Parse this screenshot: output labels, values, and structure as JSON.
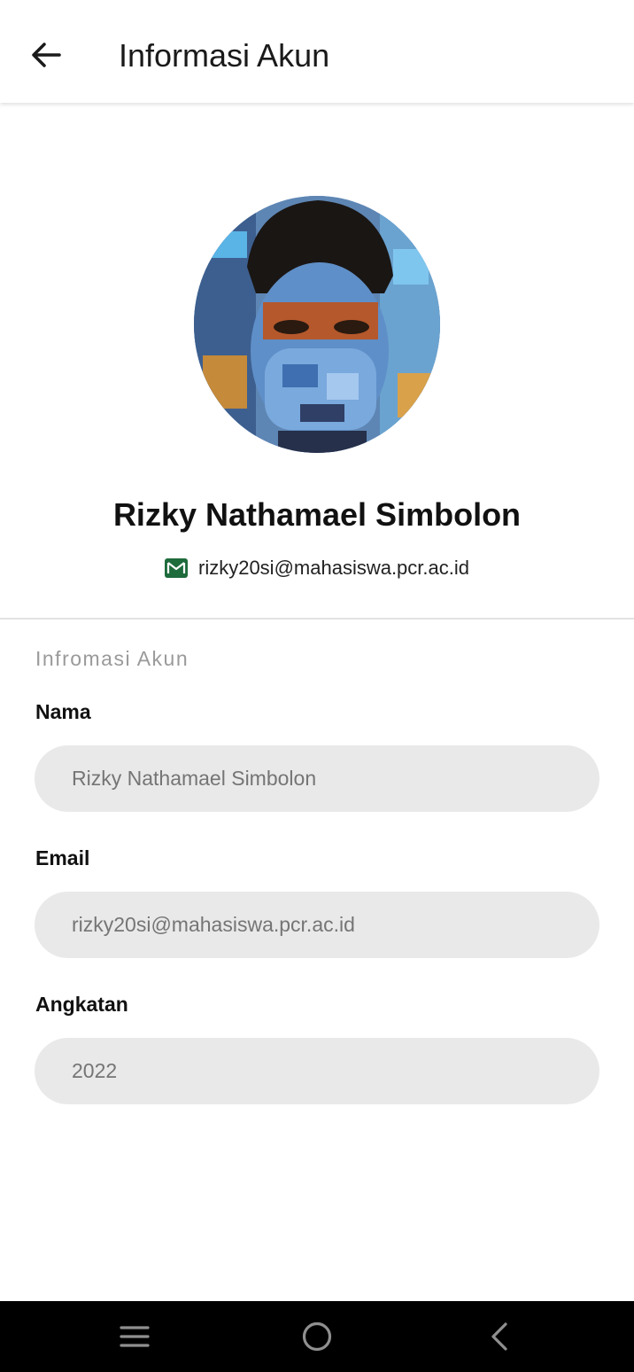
{
  "appbar": {
    "title": "Informasi Akun",
    "back_icon": "arrow-left-icon"
  },
  "profile": {
    "name": "Rizky Nathamael Simbolon",
    "email": "rizky20si@mahasiswa.pcr.ac.id",
    "email_icon": "mail-icon",
    "email_icon_color": "#1e6b3c"
  },
  "section": {
    "title": "Infromasi Akun"
  },
  "fields": [
    {
      "label": "Nama",
      "value": "Rizky Nathamael Simbolon"
    },
    {
      "label": "Email",
      "value": "rizky20si@mahasiswa.pcr.ac.id"
    },
    {
      "label": "Angkatan",
      "value": "2022"
    }
  ],
  "navbar": {
    "recents_icon": "recents-icon",
    "home_icon": "home-circle-icon",
    "back_icon": "chevron-left-icon"
  }
}
